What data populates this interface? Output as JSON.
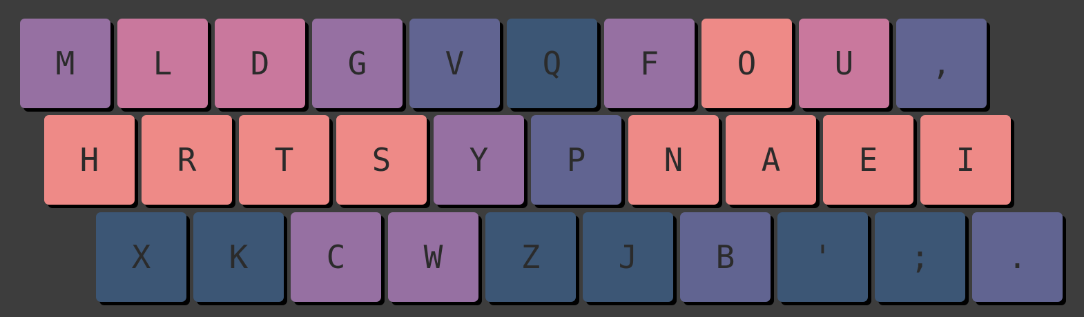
{
  "colors": {
    "background": "#3d3d3d",
    "key_text": "#2b2b2b",
    "salmon": "#ee8a87",
    "pink": "#c9789d",
    "purple": "#9670a2",
    "indigo": "#616491",
    "navy": "#3c5675"
  },
  "keyboard": {
    "rows": [
      {
        "name": "top",
        "keys": [
          {
            "label": "M",
            "tone": "purple"
          },
          {
            "label": "L",
            "tone": "pink"
          },
          {
            "label": "D",
            "tone": "pink"
          },
          {
            "label": "G",
            "tone": "purple"
          },
          {
            "label": "V",
            "tone": "indigo"
          },
          {
            "label": "Q",
            "tone": "navy"
          },
          {
            "label": "F",
            "tone": "purple"
          },
          {
            "label": "O",
            "tone": "salmon"
          },
          {
            "label": "U",
            "tone": "pink"
          },
          {
            "label": ",",
            "tone": "indigo"
          }
        ]
      },
      {
        "name": "home",
        "keys": [
          {
            "label": "H",
            "tone": "salmon"
          },
          {
            "label": "R",
            "tone": "salmon"
          },
          {
            "label": "T",
            "tone": "salmon"
          },
          {
            "label": "S",
            "tone": "salmon"
          },
          {
            "label": "Y",
            "tone": "purple"
          },
          {
            "label": "P",
            "tone": "indigo"
          },
          {
            "label": "N",
            "tone": "salmon"
          },
          {
            "label": "A",
            "tone": "salmon"
          },
          {
            "label": "E",
            "tone": "salmon"
          },
          {
            "label": "I",
            "tone": "salmon"
          }
        ]
      },
      {
        "name": "bottom",
        "keys": [
          {
            "label": "X",
            "tone": "navy"
          },
          {
            "label": "K",
            "tone": "navy"
          },
          {
            "label": "C",
            "tone": "purple"
          },
          {
            "label": "W",
            "tone": "purple"
          },
          {
            "label": "Z",
            "tone": "navy"
          },
          {
            "label": "J",
            "tone": "navy"
          },
          {
            "label": "B",
            "tone": "indigo"
          },
          {
            "label": "'",
            "tone": "navy"
          },
          {
            "label": ";",
            "tone": "navy"
          },
          {
            "label": ".",
            "tone": "indigo"
          }
        ]
      }
    ]
  }
}
